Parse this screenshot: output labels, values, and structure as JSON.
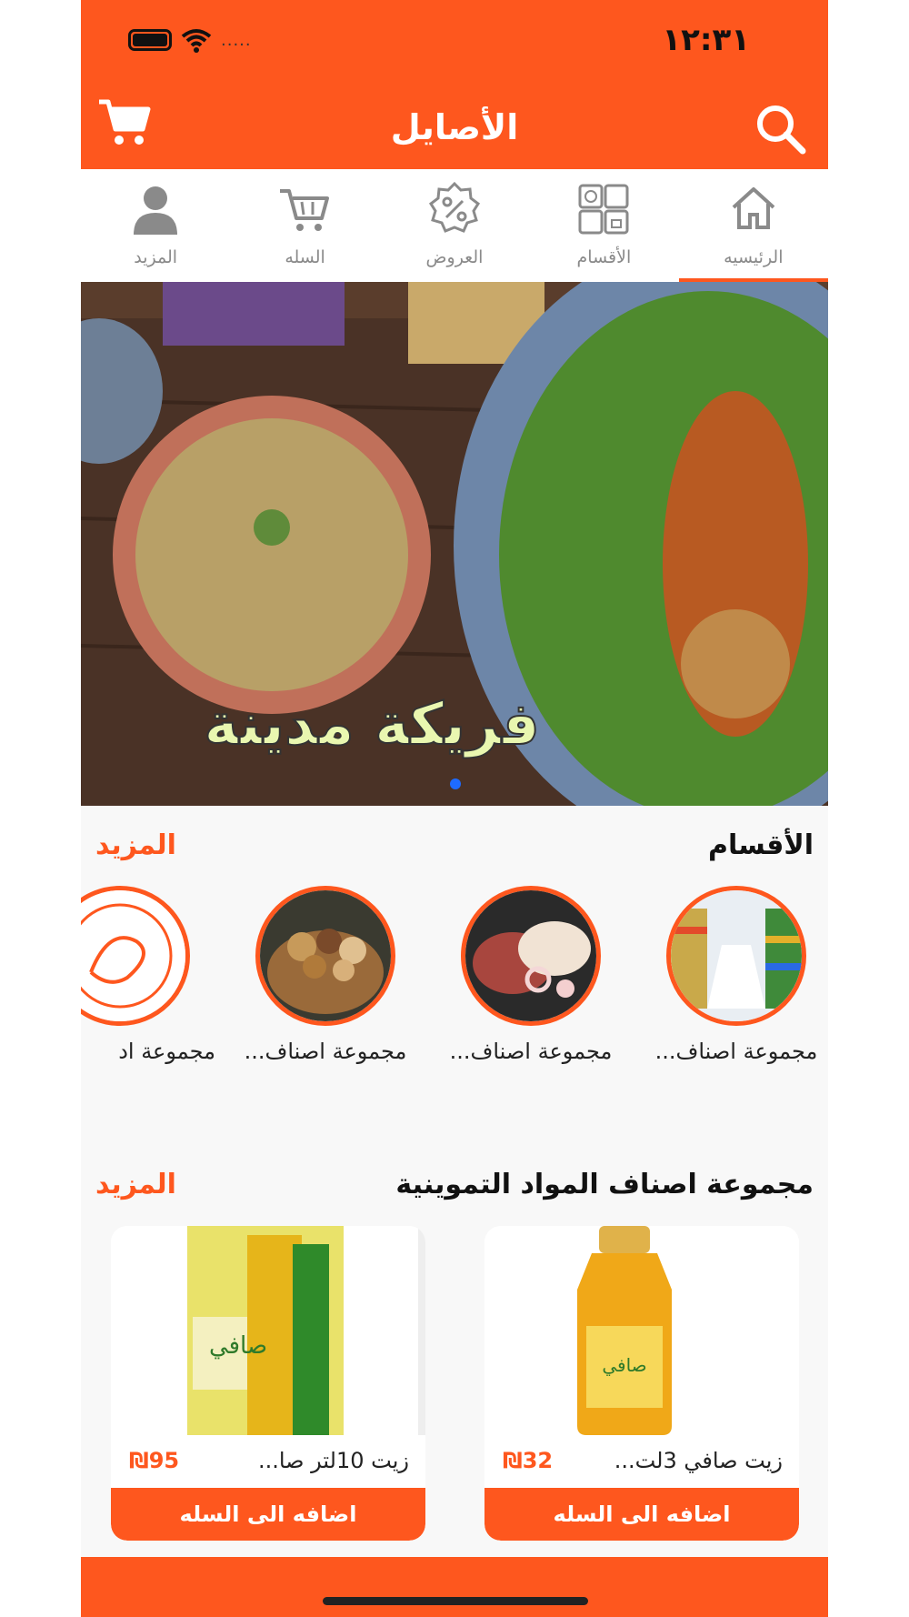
{
  "status_bar": {
    "time": "١٢:٣١",
    "signal": "....."
  },
  "header": {
    "title": "الأصايل",
    "cart_icon": "cart-icon",
    "search_icon": "search-icon"
  },
  "tabs": [
    {
      "label": "الرئيسيه",
      "icon": "home-icon",
      "active": true
    },
    {
      "label": "الأقسام",
      "icon": "categories-grid-icon",
      "active": false
    },
    {
      "label": "العروض",
      "icon": "discount-badge-icon",
      "active": false
    },
    {
      "label": "السله",
      "icon": "cart-icon",
      "active": false
    },
    {
      "label": "المزيد",
      "icon": "user-icon",
      "active": false
    }
  ],
  "banner": {
    "caption": "فريكة مدينة",
    "slide_index": 1
  },
  "categories_section": {
    "title": "الأقسام",
    "more_label": "المزيد",
    "items": [
      {
        "label": "مجموعة اصناف..."
      },
      {
        "label": "مجموعة اصناف..."
      },
      {
        "label": "مجموعة اصناف..."
      },
      {
        "label": "مجموعة اد"
      }
    ]
  },
  "products_section": {
    "title": "مجموعة اصناف المواد التموينية",
    "more_label": "المزيد",
    "items": [
      {
        "name": "زيت صافي 3لت...",
        "price": "₪32",
        "add_label": "اضافه الى السله"
      },
      {
        "name": "زيت 10لتر صا...",
        "price": "₪95",
        "add_label": "اضافه الى السله"
      }
    ]
  },
  "colors": {
    "accent": "#fe571e",
    "text": "#111111",
    "muted": "#8a8a8a"
  }
}
